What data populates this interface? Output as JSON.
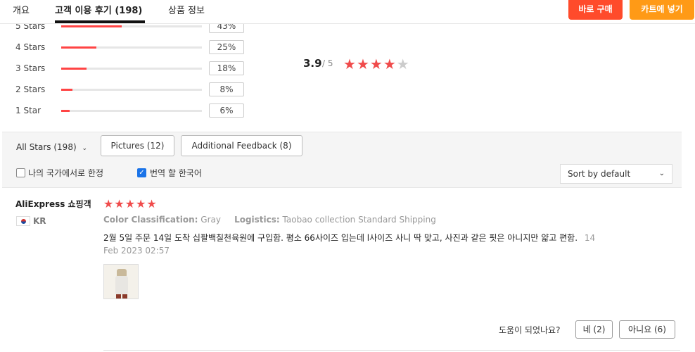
{
  "nav": {
    "tabs": [
      "개요",
      "고객 이용 후기 (198)",
      "상품 정보"
    ],
    "buy_now": "바로 구매",
    "add_to_cart": "카트에 넣기"
  },
  "ratings": {
    "rows": [
      {
        "label": "5 Stars",
        "percent": "43%",
        "fill": 0.43
      },
      {
        "label": "4 Stars",
        "percent": "25%",
        "fill": 0.25
      },
      {
        "label": "3 Stars",
        "percent": "18%",
        "fill": 0.18
      },
      {
        "label": "2 Stars",
        "percent": "8%",
        "fill": 0.08
      },
      {
        "label": "1 Star",
        "percent": "6%",
        "fill": 0.06
      }
    ],
    "average": "3.9",
    "out_of": "/ 5",
    "average_stars": 4
  },
  "filters": {
    "all_stars": "All Stars (198)",
    "pictures": "Pictures (12)",
    "additional_feedback": "Additional Feedback (8)",
    "local_only": "나의 국가에서로 한정",
    "translate": "번역 할 한국어",
    "sort": "Sort by default"
  },
  "review": {
    "reviewer": "AliExpress 쇼핑객",
    "country": "KR",
    "stars": 5,
    "color_label": "Color Classification:",
    "color_value": "Gray",
    "logistics_label": "Logistics:",
    "logistics_value": "Taobao collection Standard Shipping",
    "text": "2월 5일 주문 14일 도착 십팔백칠천육원에 구입함. 평소 66사이즈 입는데 l사이즈 사니 딱 맞고, 사진과 같은 핏은 아니지만 얇고 편함.",
    "date": "14 Feb 2023 02:57",
    "helpful_question": "도움이 되었나요?",
    "yes": "네 (2)",
    "no": "아니요 (6)"
  },
  "colors": {
    "accent_red": "#ff4b2b",
    "accent_orange": "#ff9a16",
    "star_red": "#f04b4b"
  }
}
